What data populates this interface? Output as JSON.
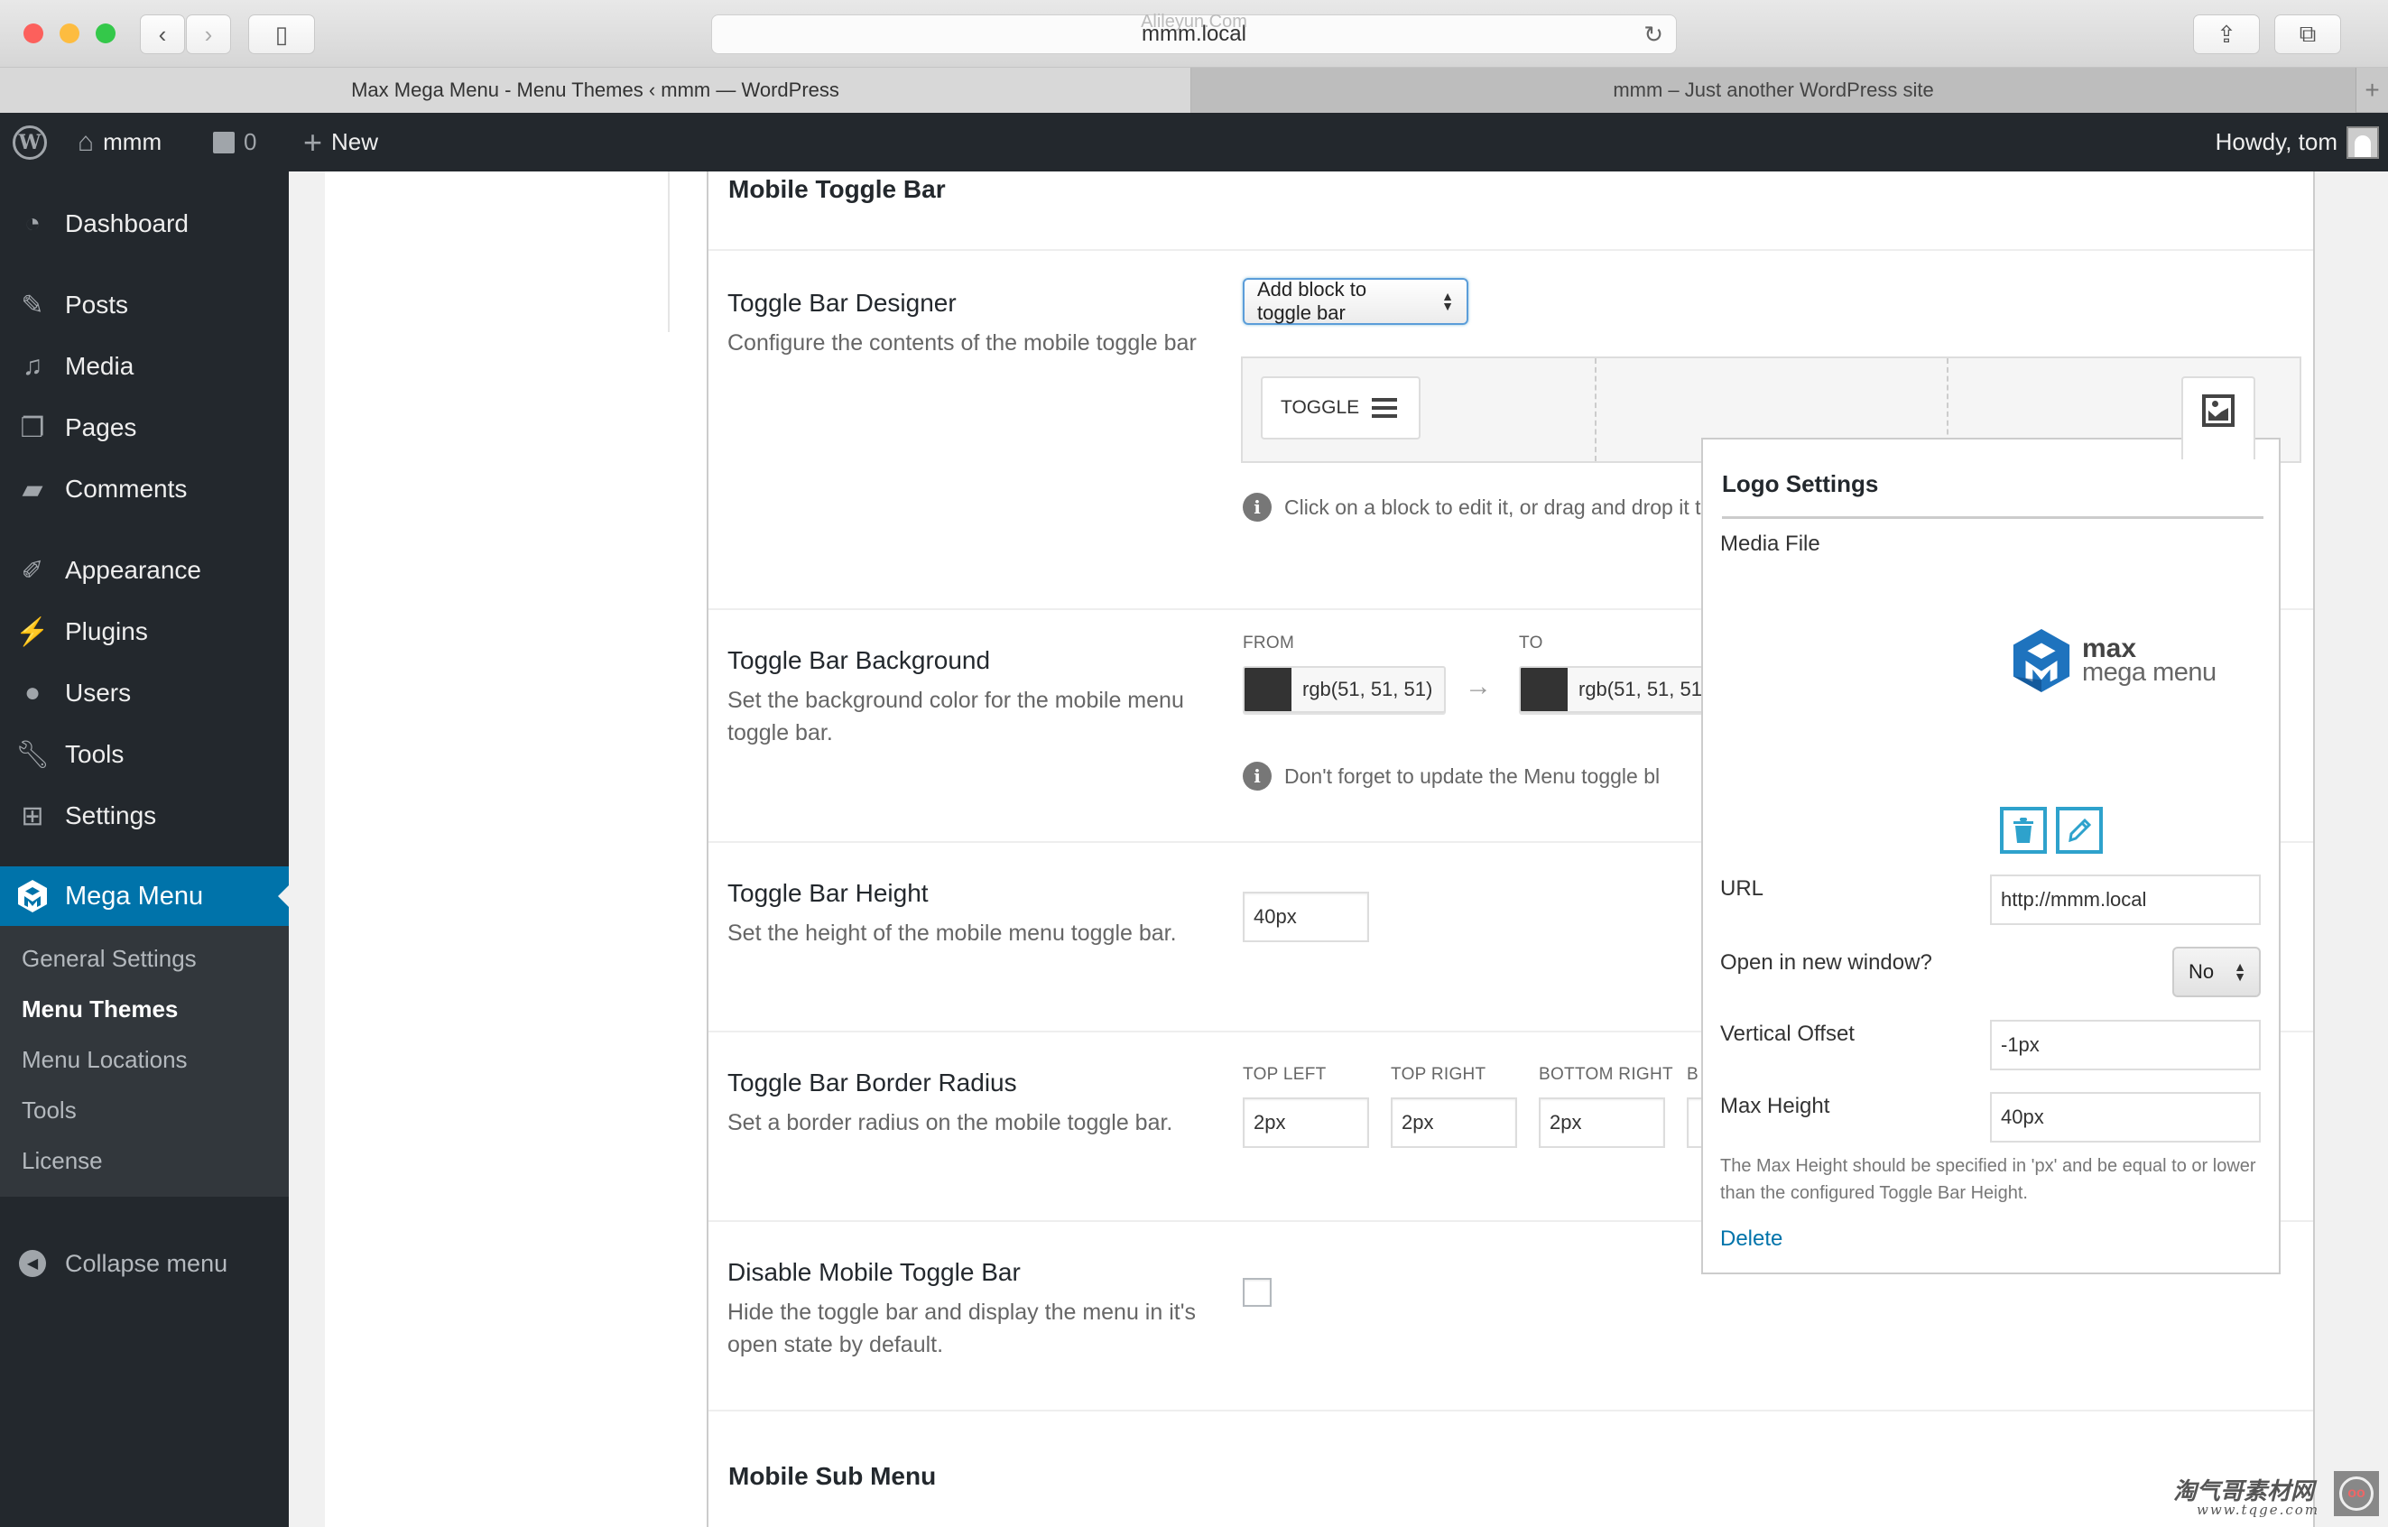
{
  "browser": {
    "url": "mmm.local",
    "url_watermark": "Alileyun.Com",
    "tabs": [
      {
        "label": "Max Mega Menu - Menu Themes ‹ mmm — WordPress",
        "active": true
      },
      {
        "label": "mmm – Just another WordPress site",
        "active": false
      }
    ],
    "icons": {
      "back": "‹",
      "forward": "›",
      "sidebar": "▯",
      "reload": "↻",
      "share": "⇪",
      "tabs": "⧉",
      "new_tab": "+"
    }
  },
  "adminbar": {
    "site_name": "mmm",
    "comments_count": "0",
    "new_label": "New",
    "greeting": "Howdy, tom"
  },
  "sidebar": {
    "items": [
      {
        "label": "Dashboard",
        "icon": "dashboard-icon"
      },
      {
        "label": "Posts",
        "icon": "pin-icon"
      },
      {
        "label": "Media",
        "icon": "media-icon"
      },
      {
        "label": "Pages",
        "icon": "pages-icon"
      },
      {
        "label": "Comments",
        "icon": "comment-icon"
      },
      {
        "label": "Appearance",
        "icon": "brush-icon"
      },
      {
        "label": "Plugins",
        "icon": "plug-icon"
      },
      {
        "label": "Users",
        "icon": "user-icon"
      },
      {
        "label": "Tools",
        "icon": "wrench-icon"
      },
      {
        "label": "Settings",
        "icon": "settings-icon"
      }
    ],
    "active": {
      "label": "Mega Menu",
      "icon": "mega-menu-icon"
    },
    "submenu": [
      {
        "label": "General Settings",
        "current": false
      },
      {
        "label": "Menu Themes",
        "current": true
      },
      {
        "label": "Menu Locations",
        "current": false
      },
      {
        "label": "Tools",
        "current": false
      },
      {
        "label": "License",
        "current": false
      }
    ],
    "collapse_label": "Collapse menu"
  },
  "main": {
    "section_title": "Mobile Toggle Bar",
    "designer": {
      "label": "Toggle Bar Designer",
      "desc": "Configure the contents of the mobile toggle bar",
      "add_block_select": "Add block to toggle bar",
      "toggle_block_label": "TOGGLE",
      "info": "Click on a block to edit it, or drag and drop it t"
    },
    "background": {
      "label": "Toggle Bar Background",
      "desc": "Set the background color for the mobile menu toggle bar.",
      "from_label": "FROM",
      "to_label": "TO",
      "from_value": "rgb(51, 51, 51)",
      "to_value": "rgb(51, 51, 51)",
      "from_color": "#333333",
      "to_color": "#333333",
      "info": "Don't forget to update the Menu toggle bl"
    },
    "height": {
      "label": "Toggle Bar Height",
      "desc": "Set the height of the mobile menu toggle bar.",
      "value": "40px"
    },
    "radius": {
      "label": "Toggle Bar Border Radius",
      "desc": "Set a border radius on the mobile toggle bar.",
      "fields": [
        {
          "label": "TOP LEFT",
          "value": "2px"
        },
        {
          "label": "TOP RIGHT",
          "value": "2px"
        },
        {
          "label": "BOTTOM RIGHT",
          "value": "2px"
        },
        {
          "label": "B",
          "value": ""
        }
      ]
    },
    "disable": {
      "label": "Disable Mobile Toggle Bar",
      "desc": "Hide the toggle bar and display the menu in it's open state by default.",
      "checked": false
    },
    "next_section_title": "Mobile Sub Menu"
  },
  "logo_popup": {
    "title": "Logo Settings",
    "media_label": "Media File",
    "logo_text_1": "max",
    "logo_text_2": "mega menu",
    "url_label": "URL",
    "url_value": "http://mmm.local",
    "newwin_label": "Open in new window?",
    "newwin_value": "No",
    "offset_label": "Vertical Offset",
    "offset_value": "-1px",
    "maxh_label": "Max Height",
    "maxh_value": "40px",
    "note": "The Max Height should be specified in 'px' and be equal to or lower than the configured Toggle Bar Height.",
    "delete_label": "Delete",
    "accent": "#2ea2cc"
  },
  "watermark": {
    "cn": "淘气哥素材网",
    "url": "www.tqge.com"
  },
  "colors": {
    "wp_dark": "#23282d",
    "wp_blue": "#0073aa",
    "submenu_bg": "#32373c"
  }
}
